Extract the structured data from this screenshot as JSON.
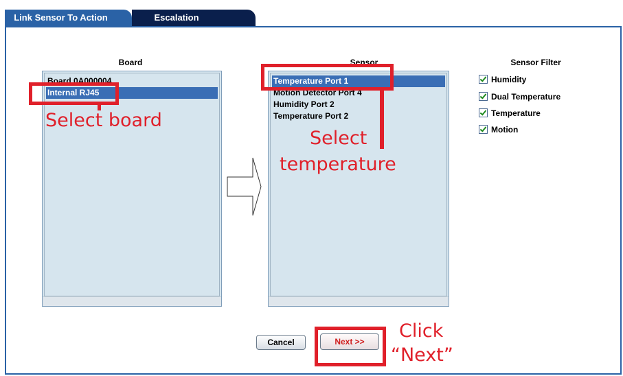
{
  "tabs": [
    {
      "label": "Link Sensor To Action",
      "active": true
    },
    {
      "label": "Escalation",
      "active": false
    }
  ],
  "board": {
    "title": "Board",
    "items": [
      "Board 0A000004",
      "Internal RJ45"
    ],
    "selected_index": 1
  },
  "sensor": {
    "title": "Sensor",
    "items": [
      "Temperature Port 1",
      "Motion Detector Port 4",
      "Humidity Port 2",
      "Temperature Port 2"
    ],
    "selected_index": 0
  },
  "sensor_filter": {
    "title": "Sensor Filter",
    "options": [
      {
        "label": "Humidity",
        "checked": true
      },
      {
        "label": "Dual Temperature",
        "checked": true
      },
      {
        "label": "Temperature",
        "checked": true
      },
      {
        "label": "Motion",
        "checked": true
      }
    ]
  },
  "buttons": {
    "cancel": "Cancel",
    "next": "Next >>"
  },
  "annotations": {
    "select_board": "Select board",
    "select_temperature_line1": "Select",
    "select_temperature_line2": "temperature",
    "click_next_line1": "Click",
    "click_next_line2": "“Next”"
  },
  "colors": {
    "annotation": "#e0202a",
    "tab_active": "#2a62a6",
    "tab_inactive": "#0a1f4c",
    "list_bg": "#d6e5ee",
    "selected_row": "#3a6eb5"
  }
}
